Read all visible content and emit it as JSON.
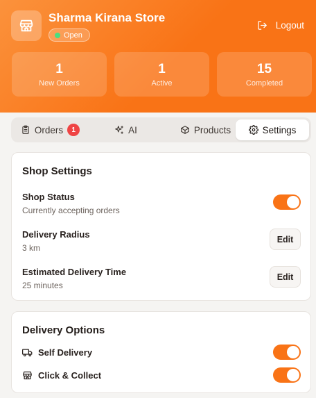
{
  "header": {
    "store_name": "Sharma Kirana Store",
    "status": "Open",
    "logout_label": "Logout",
    "stats": [
      {
        "value": "1",
        "label": "New Orders"
      },
      {
        "value": "1",
        "label": "Active"
      },
      {
        "value": "15",
        "label": "Completed"
      }
    ]
  },
  "tabs": [
    {
      "label": "Orders",
      "badge": "1",
      "icon": "clipboard-icon"
    },
    {
      "label": "AI",
      "icon": "sparkles-icon"
    },
    {
      "label": "Products",
      "icon": "box-icon"
    },
    {
      "label": "Settings",
      "icon": "gear-icon",
      "active": true
    }
  ],
  "shop_settings": {
    "title": "Shop Settings",
    "status_title": "Shop Status",
    "status_sub": "Currently accepting orders",
    "status_on": true,
    "radius_title": "Delivery Radius",
    "radius_value": "3 km",
    "time_title": "Estimated Delivery Time",
    "time_value": "25 minutes",
    "edit_label": "Edit"
  },
  "delivery_options": {
    "title": "Delivery Options",
    "options": [
      {
        "label": "Self Delivery",
        "icon": "truck-icon",
        "on": true
      },
      {
        "label": "Click & Collect",
        "icon": "store-icon",
        "on": true
      }
    ]
  },
  "colors": {
    "accent": "#f97316",
    "badge": "#ef4444",
    "online": "#4ade80"
  }
}
